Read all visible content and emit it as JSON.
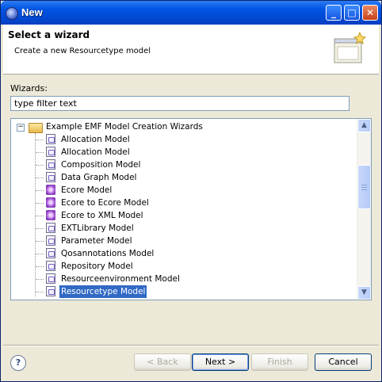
{
  "window": {
    "title": "New",
    "controls": [
      "_",
      "□",
      "✕"
    ]
  },
  "header": {
    "title": "Select a wizard",
    "description": "Create a new Resourcetype model"
  },
  "wizards_label": "Wizards:",
  "filter": {
    "value": "type filter text"
  },
  "tree": {
    "category": {
      "label": "Example EMF Model Creation Wizards",
      "expanded": true,
      "toggle": "−"
    },
    "items": [
      {
        "label": "Allocation Model",
        "icon": "model-doc-icon"
      },
      {
        "label": "Allocation Model",
        "icon": "model-doc-icon"
      },
      {
        "label": "Composition Model",
        "icon": "model-doc-icon"
      },
      {
        "label": "Data Graph Model",
        "icon": "model-doc-icon"
      },
      {
        "label": "Ecore Model",
        "icon": "ecore-icon"
      },
      {
        "label": "Ecore to Ecore Model",
        "icon": "ecore-icon"
      },
      {
        "label": "Ecore to XML Model",
        "icon": "ecore-icon"
      },
      {
        "label": "EXTLibrary Model",
        "icon": "model-doc-icon"
      },
      {
        "label": "Parameter Model",
        "icon": "model-doc-icon"
      },
      {
        "label": "Qosannotations Model",
        "icon": "model-doc-icon"
      },
      {
        "label": "Repository Model",
        "icon": "model-doc-icon"
      },
      {
        "label": "Resourceenvironment Model",
        "icon": "model-doc-icon"
      },
      {
        "label": "Resourcetype Model",
        "icon": "model-doc-icon",
        "selected": true
      }
    ]
  },
  "scrollbar": {
    "up": "▲",
    "down": "▼"
  },
  "buttons": {
    "help": "?",
    "back": "< Back",
    "next": "Next >",
    "finish": "Finish",
    "cancel": "Cancel"
  }
}
